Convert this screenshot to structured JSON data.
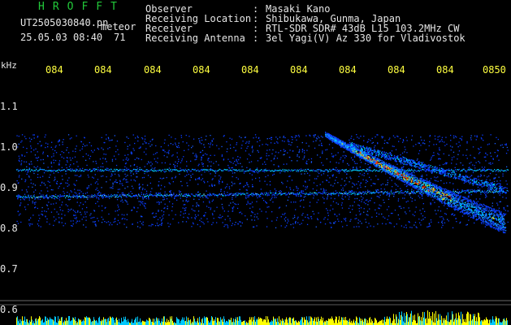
{
  "header": {
    "brand": "HROFFT",
    "filename": "UT2505030840.pn",
    "meteor_label": "meteor",
    "datetime": "25.05.03 08:40",
    "count": "71"
  },
  "info": [
    {
      "label": "Observer",
      "value": "Masaki Kano"
    },
    {
      "label": "Receiving Location",
      "value": "Shibukawa, Gunma, Japan"
    },
    {
      "label": "Receiver",
      "value": "RTL-SDR SDR# 43dB L15 103.2MHz CW"
    },
    {
      "label": "Receiving Antenna",
      "value": "3el Yagi(V) Az 330 for Vladivostok"
    }
  ],
  "info_colon": ":",
  "axis": {
    "unit_label": "kHz",
    "y_ticks": [
      "1.1",
      "1.0",
      "0.9",
      "0.8",
      "0.7",
      "0.6"
    ],
    "x_ticks": [
      "084",
      "084",
      "084",
      "084",
      "084",
      "084",
      "084",
      "084",
      "084",
      "0850"
    ]
  },
  "colors": {
    "background": "#000000",
    "brand": "#22c93a",
    "text": "#e6e6e6",
    "time_labels": "#ffff40",
    "signal_low": "#0a3cff",
    "signal_mid": "#00c8ff",
    "signal_high": "#ffff00",
    "signal_peak": "#ff3000"
  }
}
